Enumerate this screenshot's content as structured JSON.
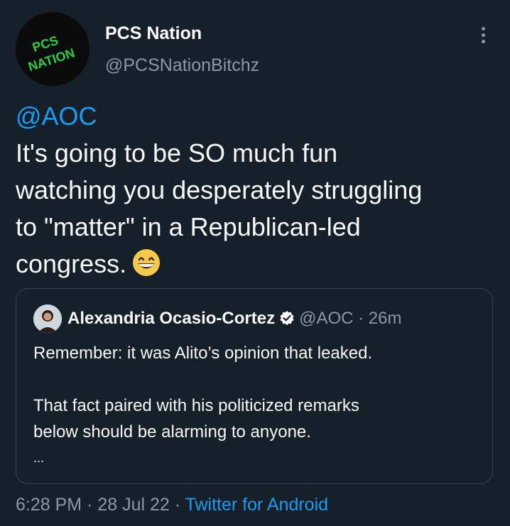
{
  "author": {
    "name": "PCS Nation",
    "handle": "@PCSNationBitchz",
    "avatar_logo_text": "PCS NATION"
  },
  "tweet": {
    "mention": "@AOC",
    "text": "It's going to be SO much fun\nwatching you desperately struggling\nto \"matter\" in a Republican-led\ncongress.",
    "emoji": "grinning-face-with-smiling-eyes"
  },
  "quoted_tweet": {
    "name": "Alexandria Ocasio-Cortez",
    "verified": true,
    "handle": "@AOC",
    "time": "· 26m",
    "line1": "Remember: it was Alito’s opinion that leaked.",
    "line2": "That fact paired with his politicized remarks",
    "line3": "below should be alarming to anyone.",
    "truncation": "..."
  },
  "footer": {
    "timestamp": "6:28 PM · 28 Jul 22 · ",
    "source": "Twitter for Android"
  },
  "colors": {
    "background": "#15202b",
    "link": "#1d9bf0",
    "secondary_text": "#8b98a5",
    "logo_green": "#2ecc40",
    "border": "#38444d"
  }
}
